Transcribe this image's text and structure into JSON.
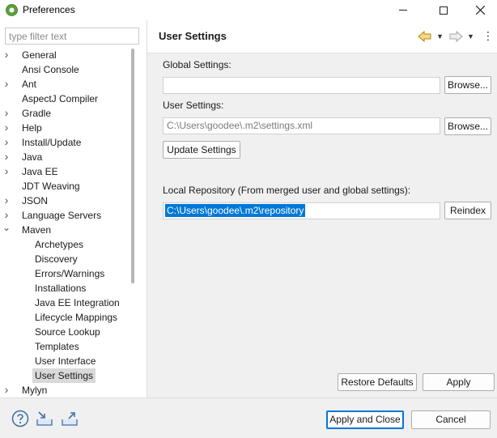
{
  "window": {
    "title": "Preferences",
    "icon": "spring-icon"
  },
  "filter": {
    "placeholder": "type filter text",
    "value": ""
  },
  "tree": {
    "items": [
      {
        "label": "General",
        "expandable": true,
        "expanded": false,
        "level": 0
      },
      {
        "label": "Ansi Console",
        "expandable": false,
        "level": 0
      },
      {
        "label": "Ant",
        "expandable": true,
        "expanded": false,
        "level": 0
      },
      {
        "label": "AspectJ Compiler",
        "expandable": false,
        "level": 0
      },
      {
        "label": "Gradle",
        "expandable": true,
        "expanded": false,
        "level": 0
      },
      {
        "label": "Help",
        "expandable": true,
        "expanded": false,
        "level": 0
      },
      {
        "label": "Install/Update",
        "expandable": true,
        "expanded": false,
        "level": 0
      },
      {
        "label": "Java",
        "expandable": true,
        "expanded": false,
        "level": 0
      },
      {
        "label": "Java EE",
        "expandable": true,
        "expanded": false,
        "level": 0
      },
      {
        "label": "JDT Weaving",
        "expandable": false,
        "level": 0
      },
      {
        "label": "JSON",
        "expandable": true,
        "expanded": false,
        "level": 0
      },
      {
        "label": "Language Servers",
        "expandable": true,
        "expanded": false,
        "level": 0
      },
      {
        "label": "Maven",
        "expandable": true,
        "expanded": true,
        "level": 0
      },
      {
        "label": "Archetypes",
        "expandable": false,
        "level": 1
      },
      {
        "label": "Discovery",
        "expandable": false,
        "level": 1
      },
      {
        "label": "Errors/Warnings",
        "expandable": false,
        "level": 1
      },
      {
        "label": "Installations",
        "expandable": false,
        "level": 1
      },
      {
        "label": "Java EE Integration",
        "expandable": false,
        "level": 1
      },
      {
        "label": "Lifecycle Mappings",
        "expandable": false,
        "level": 1
      },
      {
        "label": "Source Lookup",
        "expandable": false,
        "level": 1
      },
      {
        "label": "Templates",
        "expandable": false,
        "level": 1
      },
      {
        "label": "User Interface",
        "expandable": false,
        "level": 1
      },
      {
        "label": "User Settings",
        "expandable": false,
        "level": 1,
        "selected": true
      },
      {
        "label": "Mylyn",
        "expandable": true,
        "expanded": false,
        "level": 0
      }
    ]
  },
  "page": {
    "title": "User Settings",
    "global_settings_label": "Global Settings:",
    "global_settings_value": "",
    "user_settings_label": "User Settings:",
    "user_settings_value": "C:\\Users\\goodee\\.m2\\settings.xml",
    "browse_label": "Browse...",
    "update_settings_label": "Update Settings",
    "local_repo_label": "Local Repository (From merged user and global settings):",
    "local_repo_value": "C:\\Users\\goodee\\.m2\\repository",
    "reindex_label": "Reindex",
    "restore_defaults_label": "Restore Defaults",
    "apply_label": "Apply"
  },
  "footer": {
    "apply_close_label": "Apply and Close",
    "cancel_label": "Cancel",
    "icons": [
      "help-icon",
      "import-icon",
      "export-icon"
    ]
  },
  "colors": {
    "selection": "#0078d7",
    "tree_selected": "#d9d9d9",
    "panel_bg": "#f0f0f0",
    "default_button_border": "#0078d7"
  }
}
